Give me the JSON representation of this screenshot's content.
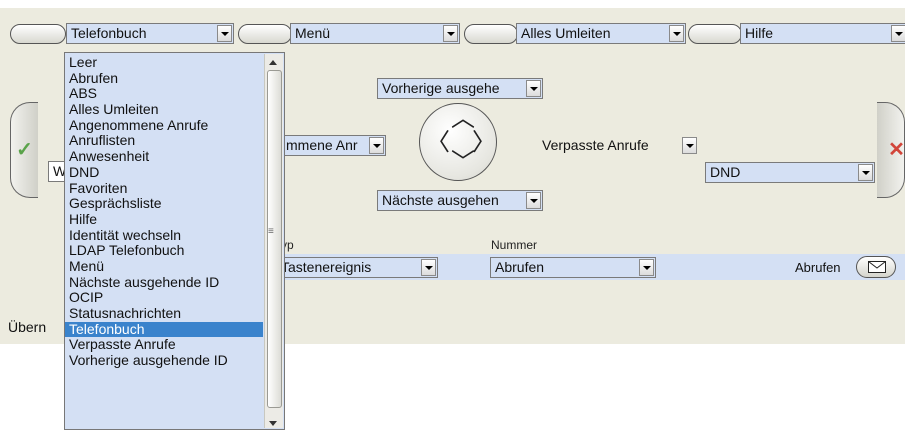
{
  "top_bar": {
    "telefonbuch_select": "Telefonbuch",
    "menu_select": "Menü",
    "umleiten_select": "Alles Umleiten",
    "hilfe_select": "Hilfe"
  },
  "dropdown_list": {
    "items": [
      "Leer",
      "Abrufen",
      "ABS",
      "Alles Umleiten",
      "Angenommene Anrufe",
      "Anruflisten",
      "Anwesenheit",
      "DND",
      "Favoriten",
      "Gesprächsliste",
      "Hilfe",
      "Identität wechseln",
      "LDAP Telefonbuch",
      "Menü",
      "Nächste ausgehende ID",
      "OCIP",
      "Statusnachrichten",
      "Telefonbuch",
      "Verpasste Anrufe",
      "Vorherige ausgehende ID"
    ],
    "selected": "Telefonbuch"
  },
  "nav": {
    "up_select": "Vorherige ausgehe",
    "left_select": "mmene Anr",
    "right_select": "Verpasste Anrufe",
    "down_select": "Nächste ausgehen",
    "dnd_select": "DND"
  },
  "left_field_fragment": "W",
  "table": {
    "col_typ_header": "yp",
    "col_nummer_header": "Nummer",
    "typ_value": "Tastenereignis",
    "nummer_value": "Abrufen",
    "label_value": "Abrufen"
  },
  "bottom_left_fragment": "Übern",
  "icons": {
    "ok": "check-icon",
    "cancel": "close-icon",
    "mail": "envelope-icon"
  },
  "colors": {
    "panel_bg": "#ecebdf",
    "select_bg": "#d4e0f4",
    "selected_item": "#3a83cc",
    "ok_green": "#5aa34a",
    "cancel_red": "#d2453a"
  }
}
